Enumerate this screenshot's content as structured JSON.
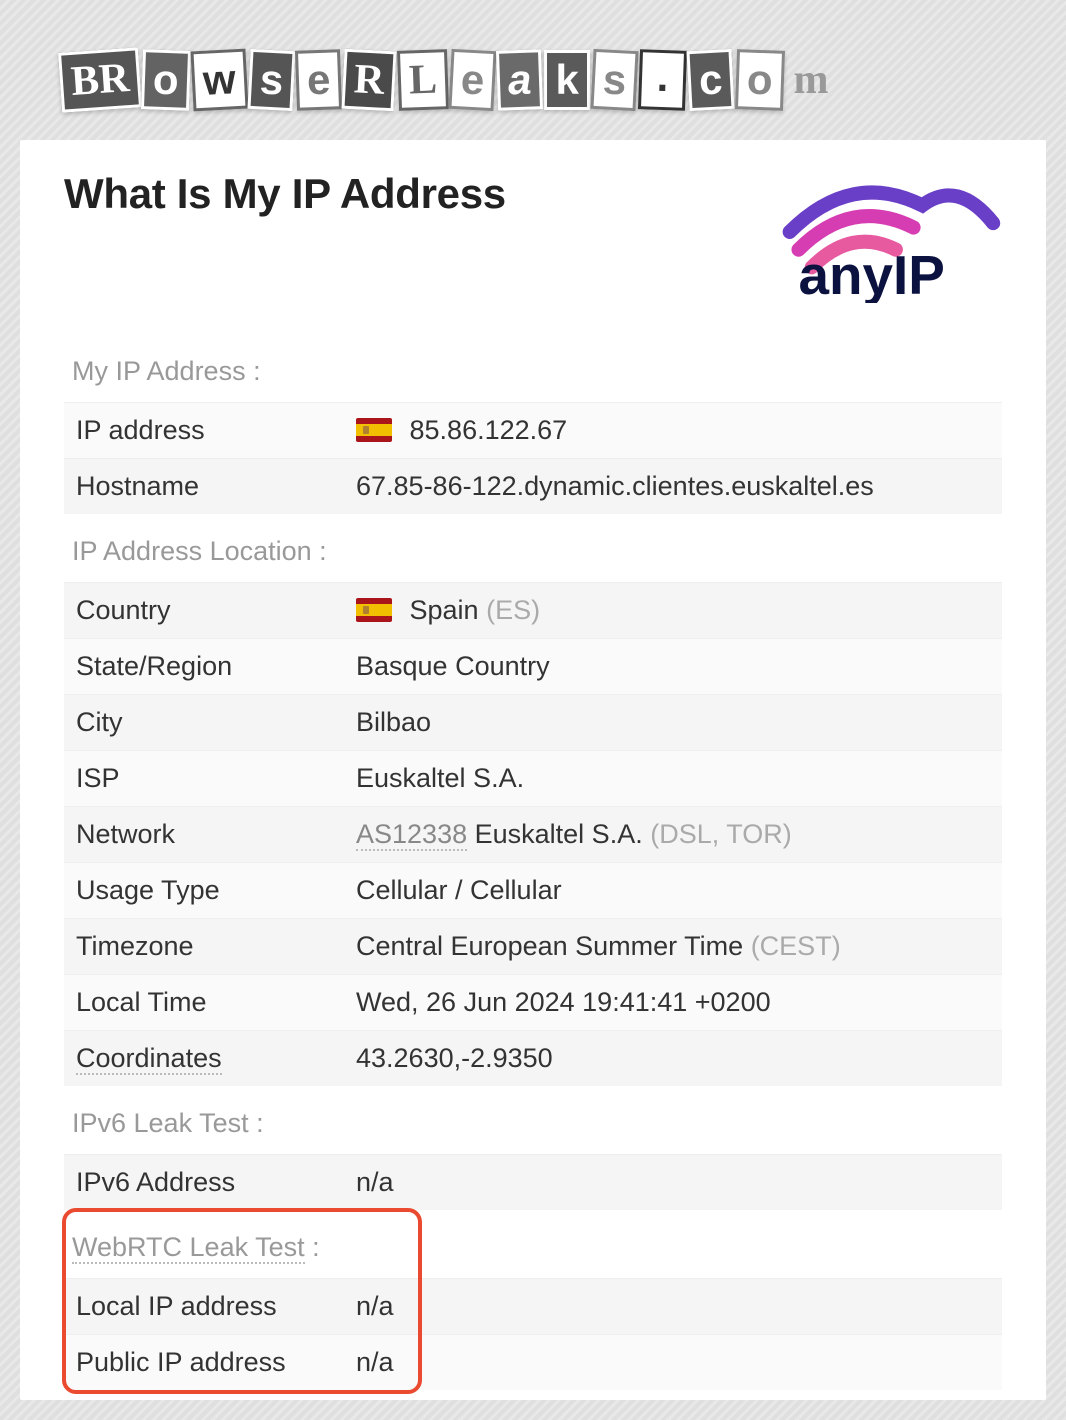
{
  "site_name": "BRowseRLeaks.com",
  "page_title": "What Is My IP Address",
  "sponsor_logo": "anyIP",
  "sections": {
    "my_ip": {
      "heading": "My IP Address :",
      "rows": {
        "ip_label": "IP address",
        "ip_value": "85.86.122.67",
        "host_label": "Hostname",
        "host_value": "67.85-86-122.dynamic.clientes.euskaltel.es"
      }
    },
    "location": {
      "heading": "IP Address Location :",
      "country_label": "Country",
      "country_value": "Spain",
      "country_code": "(ES)",
      "state_label": "State/Region",
      "state_value": "Basque Country",
      "city_label": "City",
      "city_value": "Bilbao",
      "isp_label": "ISP",
      "isp_value": "Euskaltel S.A.",
      "network_label": "Network",
      "network_asn": "AS12338",
      "network_name": "Euskaltel S.A.",
      "network_tags": "(DSL, TOR)",
      "usage_label": "Usage Type",
      "usage_value": "Cellular / Cellular",
      "tz_label": "Timezone",
      "tz_value": "Central European Summer Time",
      "tz_code": "(CEST)",
      "localtime_label": "Local Time",
      "localtime_value": "Wed, 26 Jun 2024 19:41:41 +0200",
      "coords_label": "Coordinates",
      "coords_value": "43.2630,-2.9350"
    },
    "ipv6": {
      "heading": "IPv6 Leak Test :",
      "addr_label": "IPv6 Address",
      "addr_value": "n/a"
    },
    "webrtc": {
      "heading": "WebRTC Leak Test",
      "heading_colon": " :",
      "local_label": "Local IP address",
      "local_value": "n/a",
      "public_label": "Public IP address",
      "public_value": "n/a"
    }
  }
}
